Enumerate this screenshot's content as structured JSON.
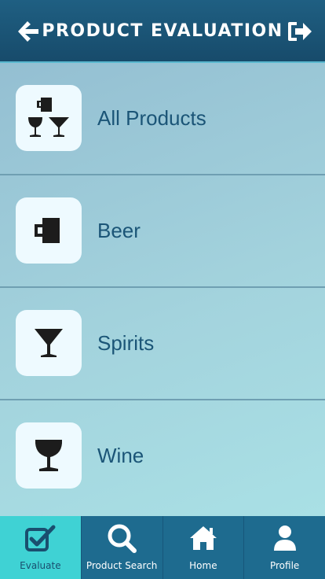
{
  "header": {
    "title": "PRODUCT EVALUATION"
  },
  "categories": [
    {
      "label": "All Products",
      "icon": "all-products-icon"
    },
    {
      "label": "Beer",
      "icon": "beer-mug-icon"
    },
    {
      "label": "Spirits",
      "icon": "cocktail-glass-icon"
    },
    {
      "label": "Wine",
      "icon": "wine-glass-icon"
    }
  ],
  "tabs": [
    {
      "label": "Evaluate",
      "icon": "checkbox-icon",
      "active": true
    },
    {
      "label": "Product Search",
      "icon": "search-icon",
      "active": false
    },
    {
      "label": "Home",
      "icon": "home-icon",
      "active": false
    },
    {
      "label": "Profile",
      "icon": "user-icon",
      "active": false
    }
  ],
  "colors": {
    "header_bg": "#1f5f82",
    "tab_bar_bg": "#1e6b8f",
    "active_tab": "#3fd2d4",
    "label_text": "#1b5577"
  }
}
